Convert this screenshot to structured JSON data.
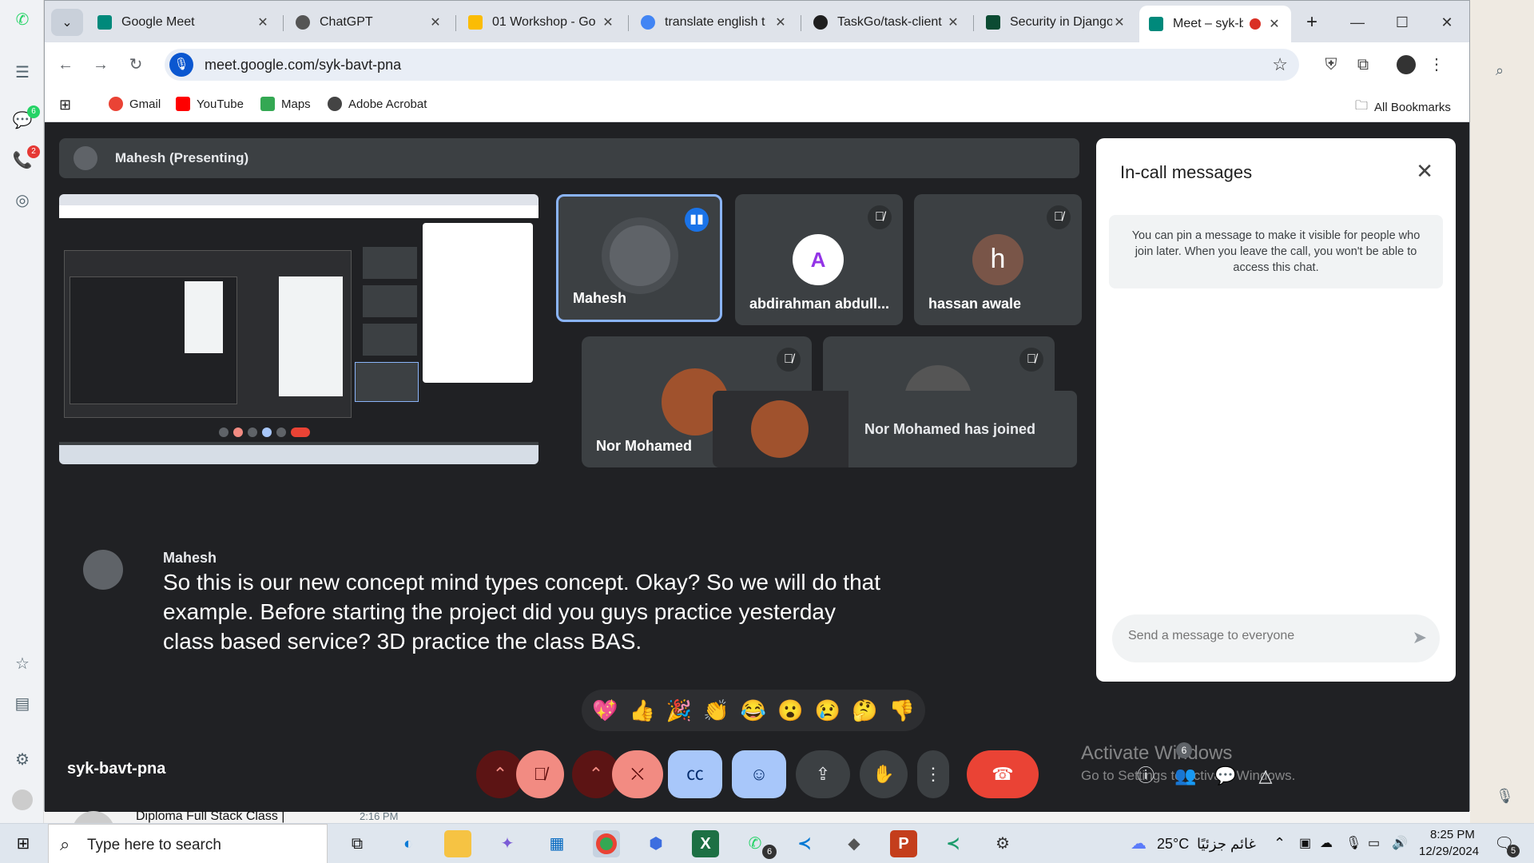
{
  "browser": {
    "tabs": [
      {
        "title": "Google Meet",
        "favicon_color": "#00897b"
      },
      {
        "title": "ChatGPT",
        "favicon_color": "#555555"
      },
      {
        "title": "01 Workshop - Go",
        "favicon_color": "#fbbc04"
      },
      {
        "title": "translate english t",
        "favicon_color": "#4285f4"
      },
      {
        "title": "TaskGo/task-client",
        "favicon_color": "#1f1f1f"
      },
      {
        "title": "Security in Django",
        "favicon_color": "#0c4b33"
      },
      {
        "title": "Meet – syk-ba",
        "favicon_color": "#00897b",
        "active": true
      }
    ],
    "url": "meet.google.com/syk-bavt-pna",
    "bookmarks": [
      {
        "label": "Gmail",
        "color": "#ea4335"
      },
      {
        "label": "YouTube",
        "color": "#ff0000"
      },
      {
        "label": "Maps",
        "color": "#34a853"
      },
      {
        "label": "Adobe Acrobat",
        "color": "#444444"
      }
    ],
    "all_bookmarks": "All Bookmarks"
  },
  "meet": {
    "presenter_label": "Mahesh (Presenting)",
    "participants": [
      {
        "name": "Mahesh",
        "speaking": true
      },
      {
        "name": "abdirahman abdull...",
        "muted": true
      },
      {
        "name": "hassan awale",
        "initial": "h",
        "muted": true
      },
      {
        "name": "Nor Mohamed",
        "muted": true
      },
      {
        "name": "",
        "muted": true
      }
    ],
    "toast": "Nor Mohamed has joined",
    "caption": {
      "speaker": "Mahesh",
      "text": "So this is our new concept mind types concept. Okay? So we will do that example. Before starting the project did you guys practice yesterday class based service? 3D practice the class BAS."
    },
    "reactions": [
      "💖",
      "👍",
      "🎉",
      "👏",
      "😂",
      "😮",
      "😢",
      "🤔",
      "👎"
    ],
    "meeting_code": "syk-bavt-pna",
    "participant_count": "6",
    "watermark": {
      "line1": "Activate Windows",
      "line2": "Go to Settings to activate Windows."
    },
    "chat": {
      "title": "In-call messages",
      "note": "You can pin a message to make it visible for people who join later. When you leave the call, you won't be able to access this chat.",
      "placeholder": "Send a message to everyone"
    },
    "background_preview": {
      "title": "Diploma Full Stack Class |",
      "time": "2:16 PM"
    }
  },
  "whatsapp_rail": {
    "chat_badge": "6",
    "calls_badge": "2"
  },
  "taskbar": {
    "search_placeholder": "Type here to search",
    "weather": "25°C",
    "weather_desc": "غائم جزئيًا",
    "time": "8:25 PM",
    "date": "12/29/2024",
    "notification_count": "5",
    "whatsapp_badge": "6"
  }
}
